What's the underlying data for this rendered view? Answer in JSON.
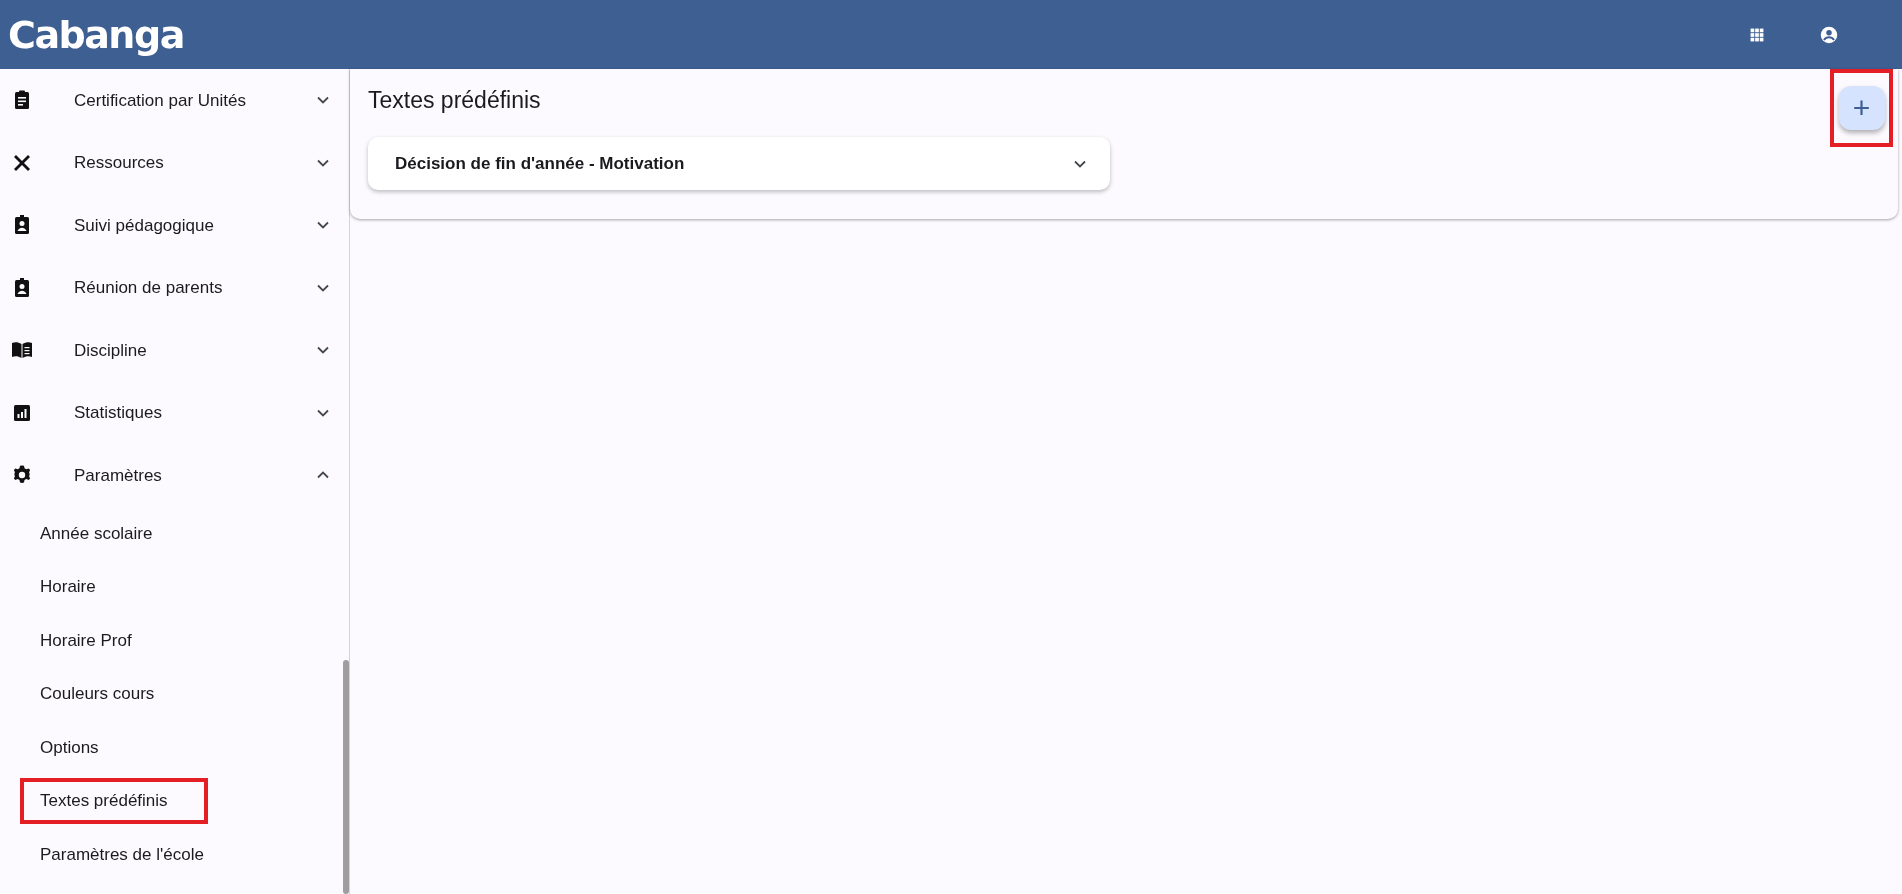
{
  "header": {
    "logo": "Cabanga"
  },
  "sidebar": {
    "items": [
      {
        "kind": "group",
        "label": "Certification par Unités",
        "expanded": false
      },
      {
        "kind": "group",
        "label": "Ressources",
        "expanded": false
      },
      {
        "kind": "group",
        "label": "Suivi pédagogique",
        "expanded": false
      },
      {
        "kind": "group",
        "label": "Réunion de parents",
        "expanded": false
      },
      {
        "kind": "group",
        "label": "Discipline",
        "expanded": false
      },
      {
        "kind": "group",
        "label": "Statistiques",
        "expanded": false
      },
      {
        "kind": "group",
        "label": "Paramètres",
        "expanded": true,
        "children": [
          {
            "label": "Année scolaire",
            "highlighted": false
          },
          {
            "label": "Horaire",
            "highlighted": false
          },
          {
            "label": "Horaire Prof",
            "highlighted": false
          },
          {
            "label": "Couleurs cours",
            "highlighted": false
          },
          {
            "label": "Options",
            "highlighted": false
          },
          {
            "label": "Textes prédéfinis",
            "highlighted": true
          },
          {
            "label": "Paramètres de l'école",
            "highlighted": false
          }
        ]
      }
    ]
  },
  "main": {
    "title": "Textes prédéfinis",
    "add_button": {
      "label": "+",
      "highlighted": true
    },
    "panels": [
      {
        "title": "Décision de fin d'année - Motivation",
        "expanded": false
      }
    ]
  }
}
